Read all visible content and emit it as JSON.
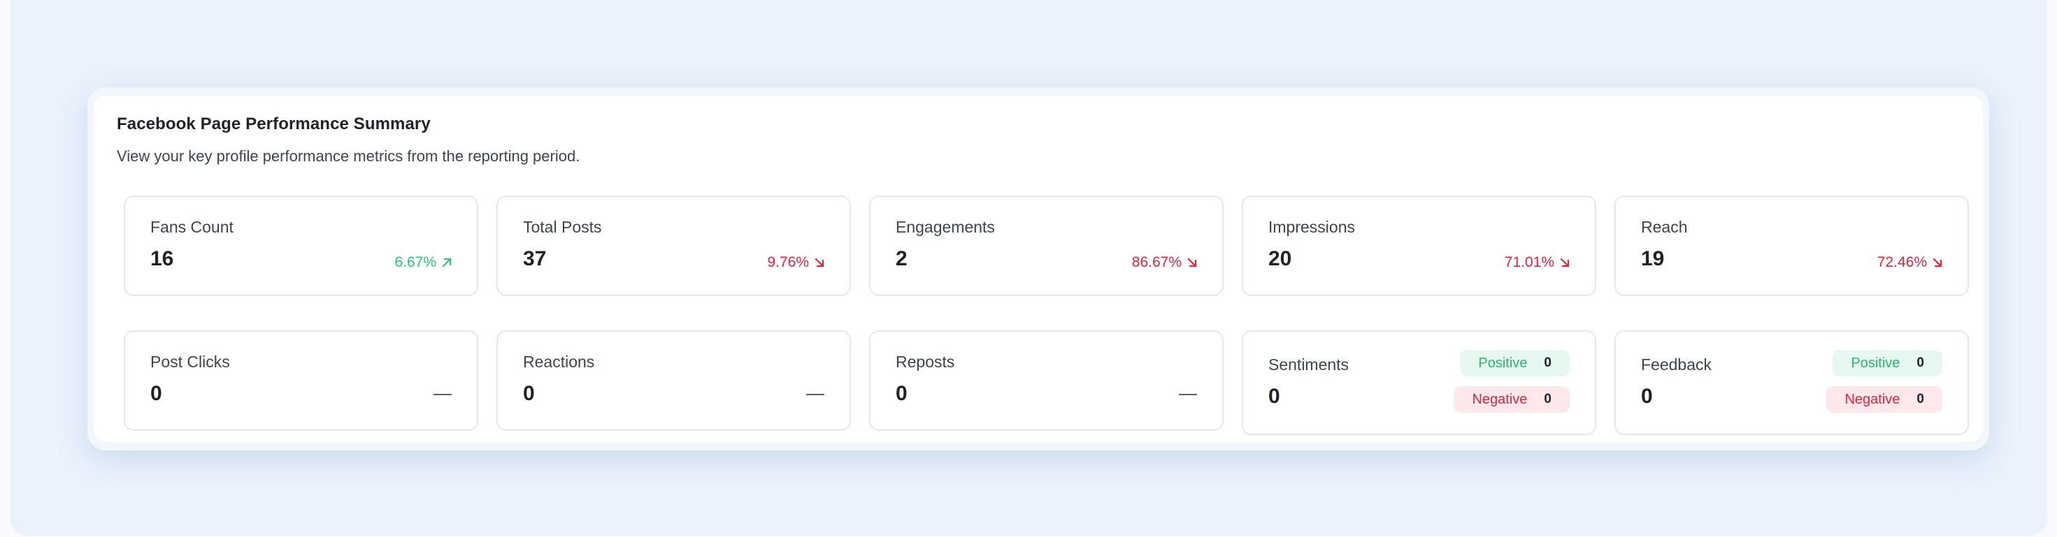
{
  "summary": {
    "title": "Facebook Page Performance Summary",
    "subtitle": "View your key profile performance metrics from the reporting period."
  },
  "metrics_row1": [
    {
      "label": "Fans Count",
      "value": "16",
      "change": "6.67%",
      "direction": "up"
    },
    {
      "label": "Total Posts",
      "value": "37",
      "change": "9.76%",
      "direction": "down"
    },
    {
      "label": "Engagements",
      "value": "2",
      "change": "86.67%",
      "direction": "down"
    },
    {
      "label": "Impressions",
      "value": "20",
      "change": "71.01%",
      "direction": "down"
    },
    {
      "label": "Reach",
      "value": "19",
      "change": "72.46%",
      "direction": "down"
    }
  ],
  "metrics_row2": [
    {
      "label": "Post Clicks",
      "value": "0",
      "change": "—"
    },
    {
      "label": "Reactions",
      "value": "0",
      "change": "—"
    },
    {
      "label": "Reposts",
      "value": "0",
      "change": "—"
    }
  ],
  "sentiments": {
    "label": "Sentiments",
    "value": "0",
    "positive_label": "Positive",
    "positive_count": "0",
    "negative_label": "Negative",
    "negative_count": "0"
  },
  "feedback": {
    "label": "Feedback",
    "value": "0",
    "positive_label": "Positive",
    "positive_count": "0",
    "negative_label": "Negative",
    "negative_count": "0"
  },
  "colors": {
    "up": "#2bc37e",
    "down": "#e0243a",
    "positive_bg": "#e6f8ef",
    "negative_bg": "#fde8ec"
  },
  "icons": {
    "up": "arrow-up-right-icon",
    "down": "arrow-down-right-icon"
  }
}
